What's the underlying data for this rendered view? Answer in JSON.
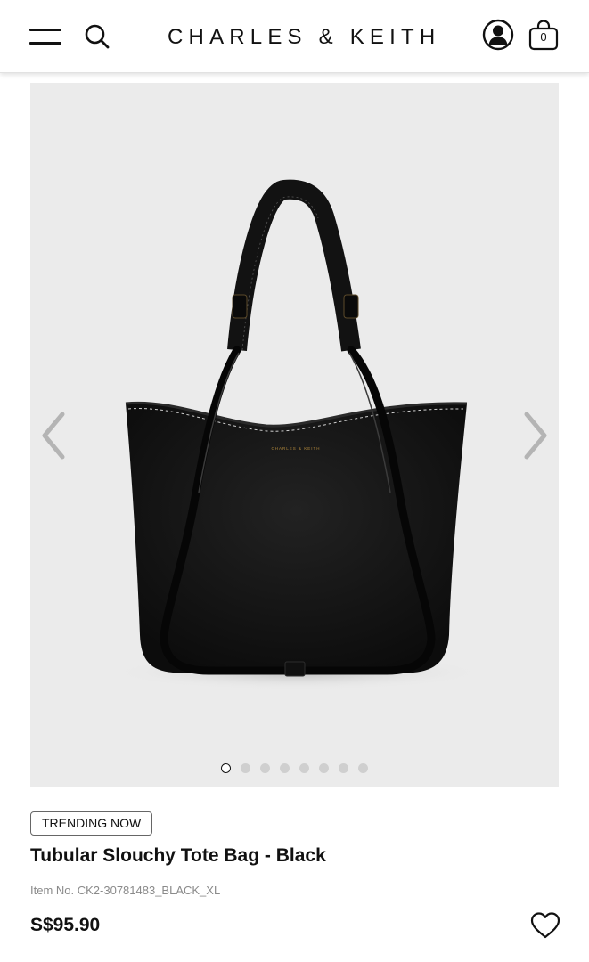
{
  "header": {
    "brand": "CHARLES & KEITH",
    "bag_count": "0",
    "icons": {
      "menu": "hamburger-menu-icon",
      "search": "search-icon",
      "account": "account-icon",
      "bag": "shopping-bag-icon"
    }
  },
  "gallery": {
    "image_subject": "black leather tote bag with tubular handles",
    "bag_logo_text": "CHARLES & KEITH",
    "dots_total": 8,
    "active_dot": 1,
    "prev_icon": "chevron-left-icon",
    "next_icon": "chevron-right-icon",
    "colors": {
      "background": "#ebebeb",
      "bag": "#141414",
      "active_dot_border": "#111111",
      "inactive_dot": "#cfcfcf"
    }
  },
  "product": {
    "badge": "TRENDING NOW",
    "name": "Tubular Slouchy Tote Bag - Black",
    "item_number": "Item No. CK2-30781483_BLACK_XL",
    "price": "S$95.90",
    "wishlist_icon": "heart-outline-icon"
  }
}
